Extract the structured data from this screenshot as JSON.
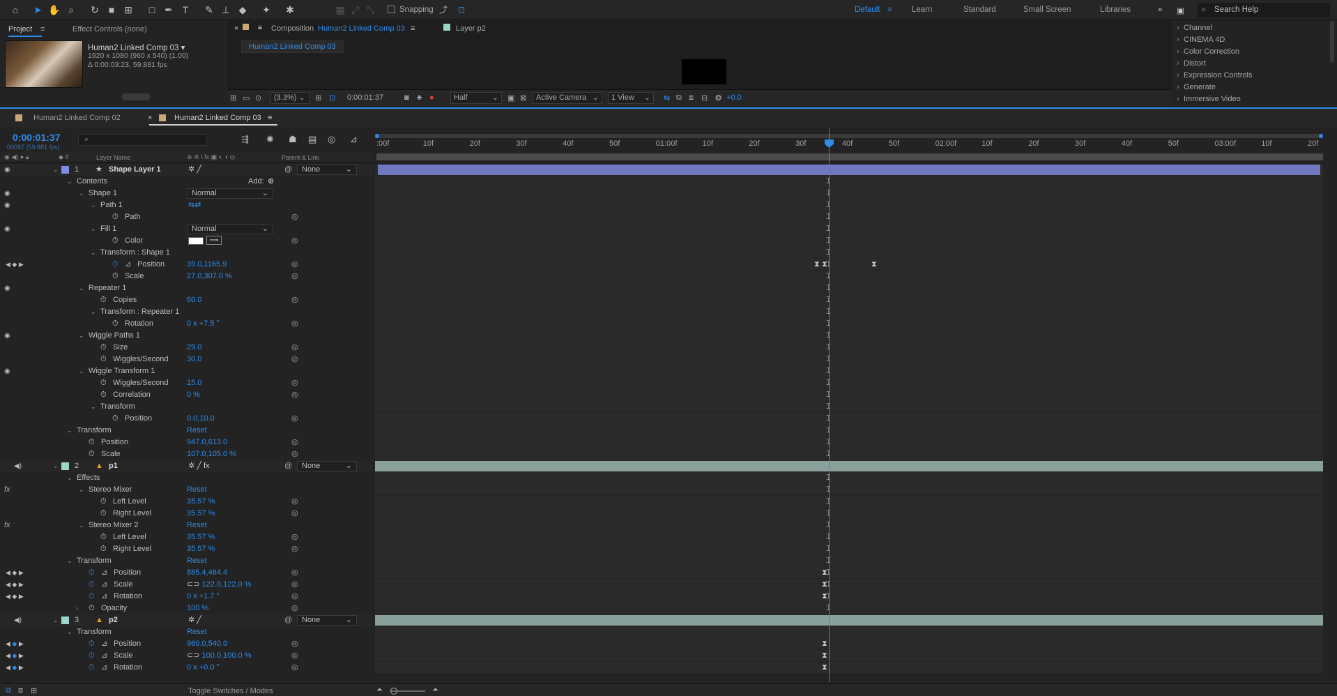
{
  "toolbar": {
    "snapping": "Snapping",
    "workspaces": [
      "Default",
      "Learn",
      "Standard",
      "Small Screen",
      "Libraries"
    ],
    "search": "Search Help"
  },
  "project": {
    "tab_project": "Project",
    "tab_effect": "Effect Controls (none)",
    "comp_name": "Human2 Linked Comp 03 ▾",
    "info1": "1920 x 1080  (960 x 540) (1.00)",
    "info2": "Δ 0:00:03:23, 59.881 fps"
  },
  "comp": {
    "tab_prefix": "Composition",
    "tab_name": "Human2 Linked Comp 03",
    "tab_layer": "Layer p2",
    "label": "Human2 Linked Comp 03",
    "zoom": "(3.3%)",
    "time": "0:00:01:37",
    "resolution": "Half",
    "camera": "Active Camera",
    "views": "1 View",
    "exposure": "+0.0"
  },
  "effects": {
    "items": [
      "Channel",
      "CINEMA 4D",
      "Color Correction",
      "Distort",
      "Expression Controls",
      "Generate",
      "Immersive Video"
    ]
  },
  "timeline": {
    "tabs": [
      "Human2 Linked Comp 02",
      "Human2 Linked Comp 03"
    ],
    "timecode": "0:00:01:37",
    "fps": "00097 (59.881 fps)",
    "col_layername": "Layer Name",
    "col_parent": "Parent & Link",
    "toggle": "Toggle Switches / Modes",
    "ruler": [
      ":00f",
      "10f",
      "20f",
      "30f",
      "40f",
      "50f",
      "01:00f",
      "10f",
      "20f",
      "30f",
      "40f",
      "50f",
      "02:00f",
      "10f",
      "20f",
      "30f",
      "40f",
      "50f",
      "03:00f",
      "10f",
      "20f"
    ]
  },
  "layers": [
    {
      "type": "layer",
      "indent": 0,
      "num": "1",
      "name": "Shape Layer 1",
      "star": true,
      "color": "#7e8ce8",
      "parent": "None",
      "eye": true
    },
    {
      "type": "group",
      "indent": 1,
      "name": "Contents",
      "add": "Add:"
    },
    {
      "type": "group",
      "indent": 2,
      "name": "Shape 1",
      "mode": "Normal",
      "eye": true
    },
    {
      "type": "group",
      "indent": 3,
      "name": "Path 1",
      "eye": true
    },
    {
      "type": "prop",
      "indent": 4,
      "name": "Path"
    },
    {
      "type": "group",
      "indent": 3,
      "name": "Fill 1",
      "mode": "Normal",
      "eye": true
    },
    {
      "type": "prop",
      "indent": 4,
      "name": "Color",
      "swatch": true
    },
    {
      "type": "group",
      "indent": 3,
      "name": "Transform : Shape 1"
    },
    {
      "type": "prop",
      "indent": 4,
      "name": "Position",
      "value": "39.0,1165.9",
      "kf": true,
      "graph": true
    },
    {
      "type": "prop",
      "indent": 4,
      "name": "Scale",
      "value": "27.0,307.0 %"
    },
    {
      "type": "group",
      "indent": 2,
      "name": "Repeater 1",
      "eye": true
    },
    {
      "type": "prop",
      "indent": 3,
      "name": "Copies",
      "value": "60.0"
    },
    {
      "type": "group",
      "indent": 3,
      "name": "Transform : Repeater 1"
    },
    {
      "type": "prop",
      "indent": 4,
      "name": "Rotation",
      "value": "0 x +7.5 °"
    },
    {
      "type": "group",
      "indent": 2,
      "name": "Wiggle Paths 1",
      "eye": true
    },
    {
      "type": "prop",
      "indent": 3,
      "name": "Size",
      "value": "29.0"
    },
    {
      "type": "prop",
      "indent": 3,
      "name": "Wiggles/Second",
      "value": "30.0"
    },
    {
      "type": "group",
      "indent": 2,
      "name": "Wiggle Transform 1",
      "eye": true
    },
    {
      "type": "prop",
      "indent": 3,
      "name": "Wiggles/Second",
      "value": "15.0"
    },
    {
      "type": "prop",
      "indent": 3,
      "name": "Correlation",
      "value": "0 %"
    },
    {
      "type": "group",
      "indent": 3,
      "name": "Transform"
    },
    {
      "type": "prop",
      "indent": 4,
      "name": "Position",
      "value": "0.0,10.0"
    },
    {
      "type": "group",
      "indent": 1,
      "name": "Transform",
      "value": "Reset"
    },
    {
      "type": "prop",
      "indent": 2,
      "name": "Position",
      "value": "947.0,613.0"
    },
    {
      "type": "prop",
      "indent": 2,
      "name": "Scale",
      "value": "107.0,105.0 %"
    },
    {
      "type": "layer",
      "indent": 0,
      "num": "2",
      "name": "p1",
      "warn": true,
      "color": "#9ad6c8",
      "parent": "None",
      "audio": true,
      "fxsw": true
    },
    {
      "type": "group",
      "indent": 1,
      "name": "Effects"
    },
    {
      "type": "group",
      "indent": 2,
      "name": "Stereo Mixer",
      "value": "Reset",
      "fx": true
    },
    {
      "type": "prop",
      "indent": 3,
      "name": "Left Level",
      "value": "35.57 %"
    },
    {
      "type": "prop",
      "indent": 3,
      "name": "Right Level",
      "value": "35.57 %"
    },
    {
      "type": "group",
      "indent": 2,
      "name": "Stereo Mixer 2",
      "value": "Reset",
      "fx": true
    },
    {
      "type": "prop",
      "indent": 3,
      "name": "Left Level",
      "value": "35.57 %"
    },
    {
      "type": "prop",
      "indent": 3,
      "name": "Right Level",
      "value": "35.57 %"
    },
    {
      "type": "group",
      "indent": 1,
      "name": "Transform",
      "value": "Reset"
    },
    {
      "type": "prop",
      "indent": 2,
      "name": "Position",
      "value": "885.4,464.4",
      "kf": true,
      "graph": true
    },
    {
      "type": "prop",
      "indent": 2,
      "name": "Scale",
      "value": "122.0,122.0 %",
      "kf": true,
      "graph": true,
      "link": true
    },
    {
      "type": "prop",
      "indent": 2,
      "name": "Rotation",
      "value": "0 x +1.7 °",
      "kf": true,
      "graph": true
    },
    {
      "type": "prop",
      "indent": 2,
      "name": "Opacity",
      "value": "100 %",
      "collapsed": true
    },
    {
      "type": "layer",
      "indent": 0,
      "num": "3",
      "name": "p2",
      "warn": true,
      "color": "#9ad6c8",
      "parent": "None",
      "audio": true
    },
    {
      "type": "group",
      "indent": 1,
      "name": "Transform",
      "value": "Reset"
    },
    {
      "type": "prop",
      "indent": 2,
      "name": "Position",
      "value": "960.0,540.0",
      "kf": true,
      "kfblue": true,
      "graph": true
    },
    {
      "type": "prop",
      "indent": 2,
      "name": "Scale",
      "value": "100.0,100.0 %",
      "kf": true,
      "kfblue": true,
      "graph": true,
      "link": true
    },
    {
      "type": "prop",
      "indent": 2,
      "name": "Rotation",
      "value": "0 x +0.0 °",
      "kf": true,
      "kfblue": true,
      "graph": true
    }
  ]
}
